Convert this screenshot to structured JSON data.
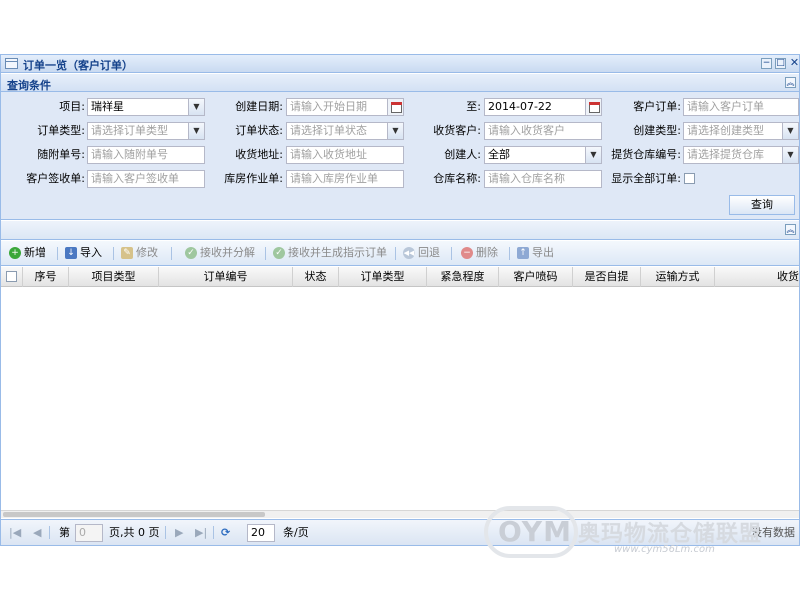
{
  "window": {
    "title": "订单一览（客户订单）",
    "controls": [
      "−",
      "□",
      "✕"
    ]
  },
  "search_panel": {
    "title": "查询条件",
    "collapse_icon": "︽"
  },
  "form": {
    "project": {
      "label": "项目:",
      "value": "瑞祥星"
    },
    "create_date": {
      "label": "创建日期:",
      "placeholder": "请输入开始日期"
    },
    "to_date": {
      "label": "至:",
      "value": "2014-07-22"
    },
    "customer_order": {
      "label": "客户订单:",
      "placeholder": "请输入客户订单"
    },
    "order_type": {
      "label": "订单类型:",
      "placeholder": "请选择订单类型"
    },
    "order_status": {
      "label": "订单状态:",
      "placeholder": "请选择订单状态"
    },
    "consignee": {
      "label": "收货客户:",
      "placeholder": "请输入收货客户"
    },
    "create_type": {
      "label": "创建类型:",
      "placeholder": "请选择创建类型"
    },
    "attach_no": {
      "label": "随附单号:",
      "placeholder": "请输入随附单号"
    },
    "delivery_address": {
      "label": "收货地址:",
      "placeholder": "请输入收货地址"
    },
    "creator": {
      "label": "创建人:",
      "value": "全部"
    },
    "pickup_warehouse": {
      "label": "提货仓库编号:",
      "placeholder": "请选择提货仓库"
    },
    "sign_receipt": {
      "label": "客户签收单:",
      "placeholder": "请输入客户签收单"
    },
    "warehouse_job": {
      "label": "库房作业单:",
      "placeholder": "请输入库房作业单"
    },
    "warehouse_name": {
      "label": "仓库名称:",
      "placeholder": "请输入仓库名称"
    },
    "show_all": {
      "label": "显示全部订单:"
    },
    "query_button": "查询"
  },
  "toolbar": {
    "add": "新增",
    "import": "导入",
    "edit": "修改",
    "receive_split": "接收并分解",
    "receive_generate": "接收并生成指示订单",
    "rollback": "回退",
    "delete": "删除",
    "export": "导出"
  },
  "grid": {
    "columns": [
      "序号",
      "项目类型",
      "订单编号",
      "状态",
      "订单类型",
      "紧急程度",
      "客户喷码",
      "是否自提",
      "运输方式",
      "收货"
    ]
  },
  "pager": {
    "page_prefix": "第",
    "page_value": "0",
    "page_suffix": "页,共 0 页",
    "page_size": "20",
    "page_size_unit": "条/页",
    "no_data": "没有数据"
  },
  "watermark": {
    "logo": "OYM",
    "text": "奥玛物流仓储联盟",
    "url": "www.cym56Lm.com"
  },
  "colors": {
    "border": "#99bbe8",
    "form_bg": "#dfe8f6",
    "title_text": "#15428b"
  }
}
